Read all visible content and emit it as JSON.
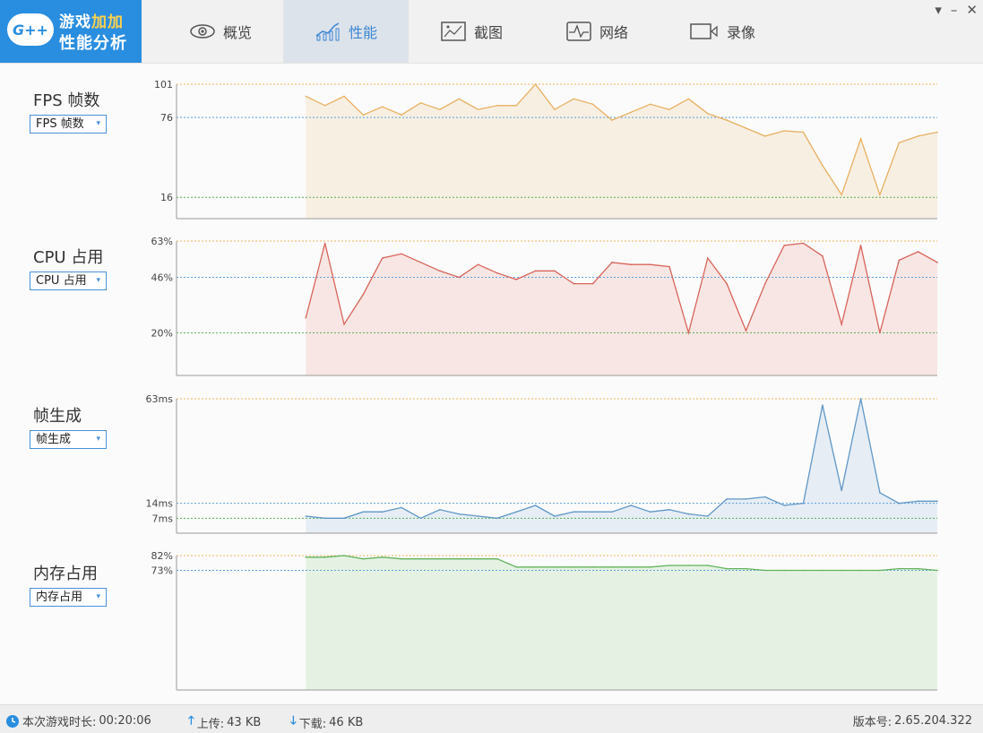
{
  "logo": {
    "badge": "G++",
    "line1_a": "游戏",
    "line1_b": "加加",
    "line2": "性能分析"
  },
  "tabs": [
    {
      "label": "概览",
      "icon": "eye-icon",
      "active": false
    },
    {
      "label": "性能",
      "icon": "performance-chart-icon",
      "active": true
    },
    {
      "label": "截图",
      "icon": "screenshot-icon",
      "active": false
    },
    {
      "label": "网络",
      "icon": "network-icon",
      "active": false
    },
    {
      "label": "录像",
      "icon": "video-camera-icon",
      "active": false
    }
  ],
  "window_controls": {
    "menu": "▾",
    "minimize": "–",
    "close": "✕"
  },
  "panels": [
    {
      "title": "FPS 帧数",
      "select": "FPS 帧数"
    },
    {
      "title": "CPU 占用",
      "select": "CPU 占用"
    },
    {
      "title": "帧生成",
      "select": "帧生成"
    },
    {
      "title": "内存占用",
      "select": "内存占用"
    }
  ],
  "colors": {
    "accent": "#2a8ee0",
    "fps": "#e8b060",
    "fps_fill": "#f7efe2",
    "cpu": "#d8645a",
    "cpu_fill": "#f8e6e4",
    "frame": "#5f97c6",
    "frame_fill": "#e6edf5",
    "mem": "#62b35c",
    "mem_fill": "#e5f2e3",
    "ref_max": "#f2b45a",
    "ref_avg": "#5aa0e0",
    "ref_min": "#55b055"
  },
  "chart_data": [
    {
      "type": "line",
      "name": "fps",
      "ylim": [
        0,
        101
      ],
      "ref_lines": [
        {
          "value": 101,
          "label": "101",
          "kind": "max"
        },
        {
          "value": 76,
          "label": "76",
          "kind": "avg"
        },
        {
          "value": 16,
          "label": "16",
          "kind": "min"
        }
      ],
      "x_start": 0.17,
      "values": [
        92,
        85,
        92,
        78,
        84,
        78,
        87,
        82,
        90,
        82,
        85,
        85,
        101,
        82,
        90,
        86,
        74,
        80,
        86,
        82,
        90,
        79,
        74,
        68,
        62,
        66,
        65,
        40,
        18,
        60,
        18,
        57,
        62,
        65
      ]
    },
    {
      "type": "line",
      "name": "cpu",
      "ylim": [
        0,
        63
      ],
      "ref_lines": [
        {
          "value": 63,
          "label": "63%",
          "kind": "max"
        },
        {
          "value": 46,
          "label": "46%",
          "kind": "avg"
        },
        {
          "value": 20,
          "label": "20%",
          "kind": "min"
        }
      ],
      "x_start": 0.17,
      "values": [
        27,
        62,
        24,
        38,
        55,
        57,
        53,
        49,
        46,
        52,
        48,
        45,
        49,
        49,
        43,
        43,
        53,
        52,
        52,
        51,
        20,
        55,
        43,
        21,
        43,
        61,
        62,
        56,
        24,
        61,
        20,
        54,
        58,
        53
      ]
    },
    {
      "type": "line",
      "name": "frame_time",
      "ylim": [
        0,
        63
      ],
      "ref_lines": [
        {
          "value": 63,
          "label": "63ms",
          "kind": "max"
        },
        {
          "value": 14,
          "label": "14ms",
          "kind": "avg"
        },
        {
          "value": 7,
          "label": "7ms",
          "kind": "min"
        }
      ],
      "x_start": 0.17,
      "values": [
        8,
        7,
        7,
        10,
        10,
        12,
        7,
        11,
        9,
        8,
        7,
        10,
        13,
        8,
        10,
        10,
        10,
        13,
        10,
        11,
        9,
        8,
        16,
        16,
        17,
        13,
        14,
        60,
        20,
        63,
        19,
        14,
        15,
        15
      ]
    },
    {
      "type": "line",
      "name": "memory",
      "ylim": [
        0,
        82
      ],
      "ref_lines": [
        {
          "value": 82,
          "label": "82%",
          "kind": "max"
        },
        {
          "value": 73,
          "label": "73%",
          "kind": "avg"
        }
      ],
      "x_start": 0.17,
      "values": [
        81,
        81,
        82,
        80,
        81,
        80,
        80,
        80,
        80,
        80,
        80,
        75,
        75,
        75,
        75,
        75,
        75,
        75,
        75,
        76,
        76,
        76,
        74,
        74,
        73,
        73,
        73,
        73,
        73,
        73,
        73,
        74,
        74,
        73
      ]
    }
  ],
  "status": {
    "duration_label": "本次游戏时长:",
    "duration": "00:20:06",
    "upload_label": "上传:",
    "upload": "43 KB",
    "download_label": "下载:",
    "download": "46 KB",
    "version_label": "版本号:",
    "version": "2.65.204.322"
  }
}
